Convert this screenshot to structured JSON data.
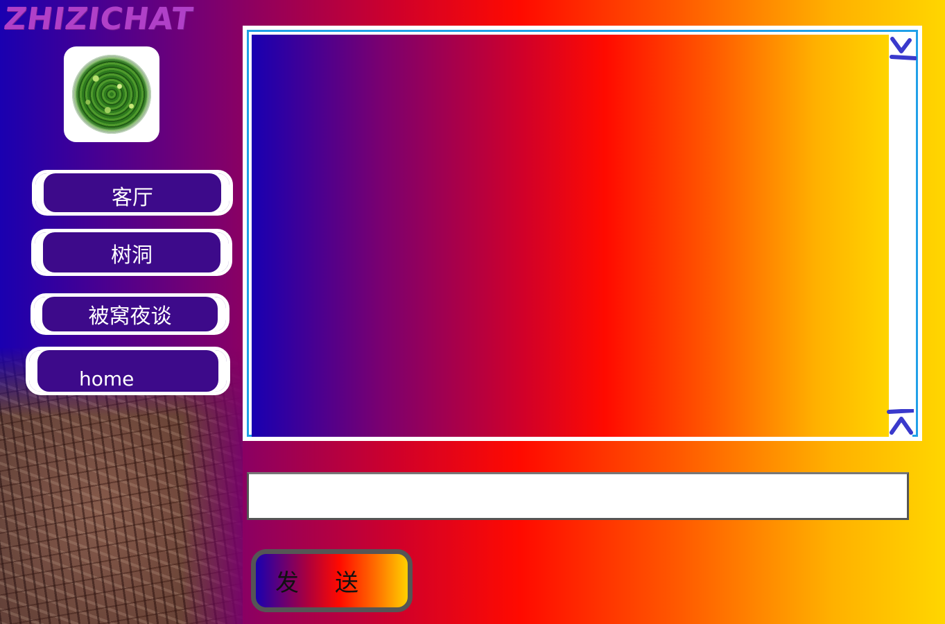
{
  "app": {
    "logo_text": "ZHIZICHAT"
  },
  "sidebar": {
    "nav": [
      {
        "label": "客厅"
      },
      {
        "label": "树洞"
      },
      {
        "label": "被窝夜谈"
      },
      {
        "label": "home"
      }
    ]
  },
  "composer": {
    "input_value": "",
    "send_label_1": "发",
    "send_label_2": "送"
  },
  "colors": {
    "accent_border": "#20a0e8",
    "scroll_arrow": "#3a3acc",
    "gradient_start": "#1a00b0",
    "gradient_mid": "#ff0a00",
    "gradient_end": "#ffd600"
  },
  "icons": {
    "scroll_down": "double-chevron-down-icon",
    "scroll_up": "double-chevron-up-icon",
    "avatar": "bush-avatar"
  }
}
